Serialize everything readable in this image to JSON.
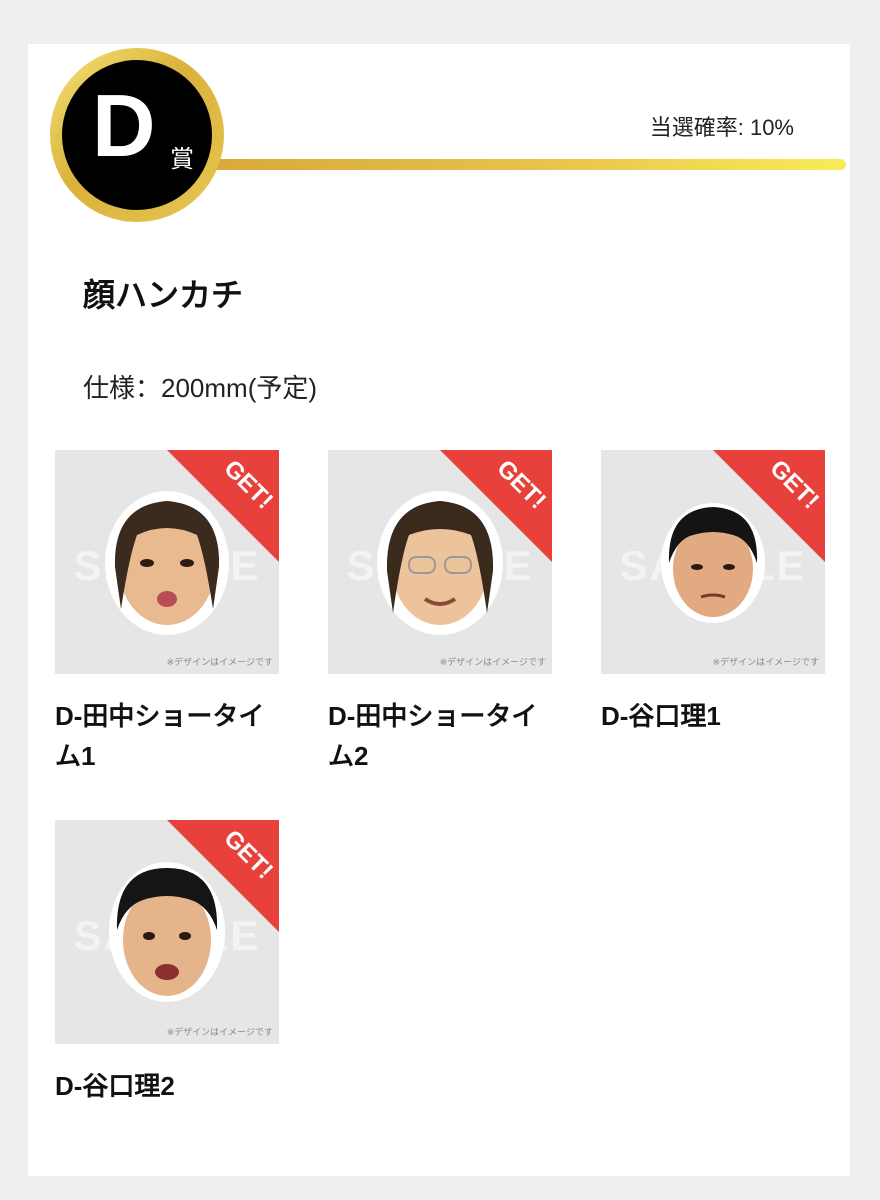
{
  "rank": {
    "letter": "D",
    "suffix": "賞"
  },
  "win_rate": "当選確率: 10%",
  "prize": {
    "title": "顔ハンカチ",
    "spec": "仕様：200mm(予定)"
  },
  "items": [
    {
      "name": "D-田中ショータイム1",
      "badge": "GET!",
      "watermark": "SAMPLE",
      "caption": "※デザインはイメージです"
    },
    {
      "name": "D-田中ショータイム2",
      "badge": "GET!",
      "watermark": "SAMPLE",
      "caption": "※デザインはイメージです"
    },
    {
      "name": "D-谷口理1",
      "badge": "GET!",
      "watermark": "SAMPLE",
      "caption": "※デザインはイメージです"
    },
    {
      "name": "D-谷口理2",
      "badge": "GET!",
      "watermark": "SAMPLE",
      "caption": "※デザインはイメージです"
    }
  ],
  "colors": {
    "gold": "#e2b93f",
    "badge_red": "#e8403a",
    "thumb_bg": "#e6e6e6"
  }
}
